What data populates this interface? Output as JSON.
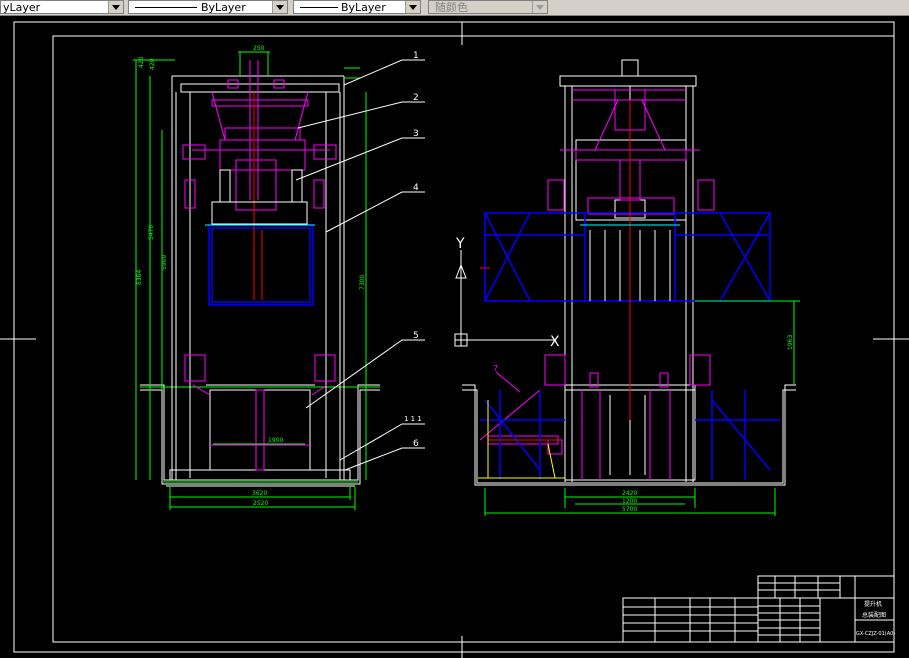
{
  "toolbar": {
    "layer_combo": "yLayer",
    "linetype_combo": "ByLayer",
    "lineweight_combo": "ByLayer",
    "plotstyle_combo": "随颜色"
  },
  "drawing": {
    "callouts": [
      "1",
      "2",
      "3",
      "4",
      "5",
      "6",
      "7"
    ],
    "section_mark": "1 1 1",
    "dims_left": {
      "top_small_a": "420",
      "top_small_b": "420",
      "top_width": "250",
      "height_overall": "8384",
      "height_mid": "5900",
      "height_upper": "5470",
      "height_right": "7300",
      "inner_width": "1900",
      "base_inner": "3620",
      "base_outer": "2520"
    },
    "dims_right": {
      "side_height": "1963",
      "base_a": "2420",
      "base_b": "1200",
      "base_outer": "5700"
    },
    "ucs": {
      "y_label": "Y",
      "x_label": "X"
    },
    "colors": {
      "frame": "#ffffff",
      "dimension": "#00ff00",
      "structure": "#ff00ff",
      "blue": "#0000ff",
      "red": "#ff0000",
      "cyan": "#00ffff",
      "yellow": "#ffff00"
    }
  },
  "title_block": {
    "title": "提升机",
    "subtitle": "总装配图",
    "drawing_no": "GX-CZJZ-01(A0)"
  }
}
